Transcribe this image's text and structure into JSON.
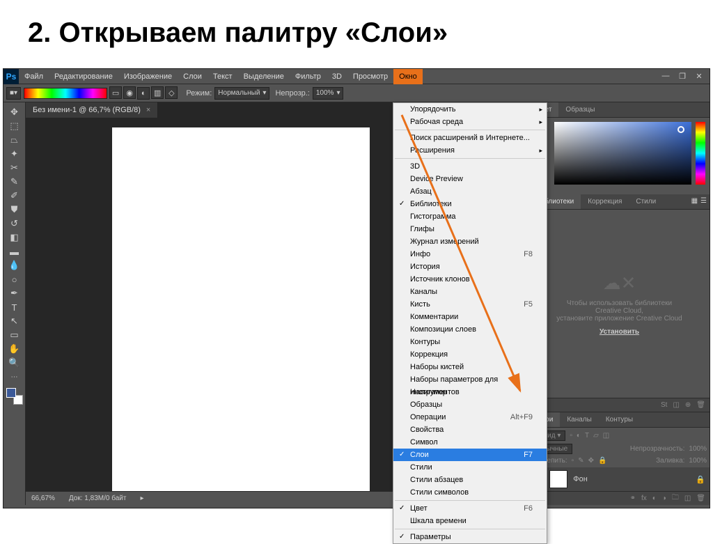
{
  "title": "2. Открываем палитру «Слои»",
  "menubar": [
    "Файл",
    "Редактирование",
    "Изображение",
    "Слои",
    "Текст",
    "Выделение",
    "Фильтр",
    "3D",
    "Просмотр",
    "Окно"
  ],
  "activeMenu": "Окно",
  "optbar": {
    "mode_label": "Режим:",
    "mode_value": "Нормальный",
    "opacity_label": "Непрозр.:",
    "opacity_value": "100%"
  },
  "docTab": "Без имени-1 @ 66,7% (RGB/8)",
  "status": {
    "zoom": "66,67%",
    "doc": "Док: 1,83M/0 байт"
  },
  "dropdown": [
    {
      "label": "Упорядочить",
      "sub": true
    },
    {
      "label": "Рабочая среда",
      "sub": true
    },
    {
      "sep": true
    },
    {
      "label": "Поиск расширений в Интернете..."
    },
    {
      "label": "Расширения",
      "sub": true
    },
    {
      "sep": true
    },
    {
      "label": "3D"
    },
    {
      "label": "Device Preview"
    },
    {
      "label": "Абзац"
    },
    {
      "label": "Библиотеки",
      "checked": true
    },
    {
      "label": "Гистограмма"
    },
    {
      "label": "Глифы"
    },
    {
      "label": "Журнал измерений"
    },
    {
      "label": "Инфо",
      "shortcut": "F8"
    },
    {
      "label": "История"
    },
    {
      "label": "Источник клонов"
    },
    {
      "label": "Каналы"
    },
    {
      "label": "Кисть",
      "shortcut": "F5"
    },
    {
      "label": "Комментарии"
    },
    {
      "label": "Композиции слоев"
    },
    {
      "label": "Контуры"
    },
    {
      "label": "Коррекция"
    },
    {
      "label": "Наборы кистей"
    },
    {
      "label": "Наборы параметров для инструментов"
    },
    {
      "label": "Навигатор"
    },
    {
      "label": "Образцы"
    },
    {
      "label": "Операции",
      "shortcut": "Alt+F9"
    },
    {
      "label": "Свойства"
    },
    {
      "label": "Символ"
    },
    {
      "label": "Слои",
      "shortcut": "F7",
      "highlight": true,
      "checked": true
    },
    {
      "label": "Стили"
    },
    {
      "label": "Стили абзацев"
    },
    {
      "label": "Стили символов"
    },
    {
      "sep": true
    },
    {
      "label": "Цвет",
      "shortcut": "F6",
      "checked": true
    },
    {
      "label": "Шкала времени"
    },
    {
      "sep": true
    },
    {
      "label": "Параметры",
      "checked": true
    }
  ],
  "panels": {
    "color_tabs": [
      "Цвет",
      "Образцы"
    ],
    "lib_tabs": [
      "Библиотеки",
      "Коррекция",
      "Стили"
    ],
    "lib_text1": "Чтобы использовать библиотеки",
    "lib_text2": "Creative Cloud,",
    "lib_text3": "установите приложение Creative Cloud",
    "install": "Установить",
    "layers_tabs": [
      "Слои",
      "Каналы",
      "Контуры"
    ],
    "kind": "Вид",
    "blend": "Обычные",
    "opacity_lbl": "Непрозрачность:",
    "opacity_val": "100%",
    "lock_lbl": "Закрепить:",
    "fill_lbl": "Заливка:",
    "fill_val": "100%",
    "layer_name": "Фон"
  }
}
